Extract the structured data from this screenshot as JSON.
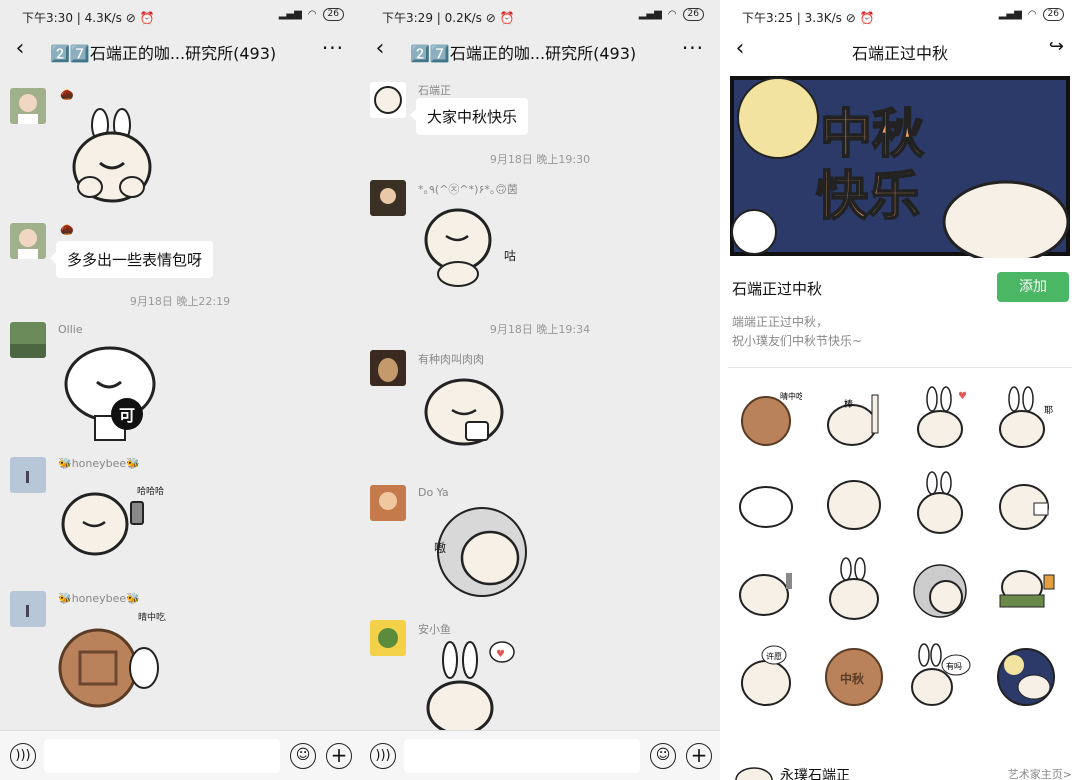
{
  "panels": [
    {
      "time": "下午3:30",
      "speed": "4.3K/s",
      "battery": "26",
      "title": "2️⃣7️⃣石端正的咖...研究所(493)",
      "input": ""
    },
    {
      "time": "下午3:29",
      "speed": "0.2K/s",
      "battery": "26",
      "title": "2️⃣7️⃣石端正的咖...研究所(493)",
      "input": ""
    },
    {
      "time": "下午3:25",
      "speed": "3.3K/s",
      "battery": "26",
      "title": "石端正过中秋"
    }
  ],
  "chat1": {
    "msg2_text": "多多出一些表情包呀",
    "ts1": "9月18日 晚上22:19",
    "sender_ollie": "Ollie",
    "sender_honeybee1": "🐝honeybee🐝",
    "sender_honeybee2": "🐝honeybee🐝",
    "sticker_text_ke": "可",
    "sticker_text_ke_side": "哈哈哈",
    "sticker_text_mooncake_side": "晴中吃月饼"
  },
  "chat2": {
    "sender1": "石端正",
    "msg1_text": "大家中秋快乐",
    "ts1": "9月18日 晚上19:30",
    "sender2": "*｡٩(^㉨^*)۶*｡🙃茵",
    "sticker2_side": "咕",
    "ts2": "9月18日 晚上19:34",
    "sender3": "有种肉叫肉肉",
    "sender4": "Do Ya",
    "sticker4_text": "嗷",
    "sender5": "安小鱼"
  },
  "pack": {
    "banner_line1": "中秋",
    "banner_line2": "快乐",
    "name": "石端正过中秋",
    "add_label": "添加",
    "desc1": "端端正正过中秋，",
    "desc2": "祝小璞友们中秋节快乐~",
    "grid_texts": [
      "晴中吃月",
      "棒",
      "",
      "耶",
      "",
      "",
      "",
      "",
      "",
      "",
      "",
      "",
      "许愿",
      "中秋",
      "有吗",
      "",
      ""
    ],
    "artist_name": "永璞石端正",
    "artist_link": "艺术家主页>"
  }
}
